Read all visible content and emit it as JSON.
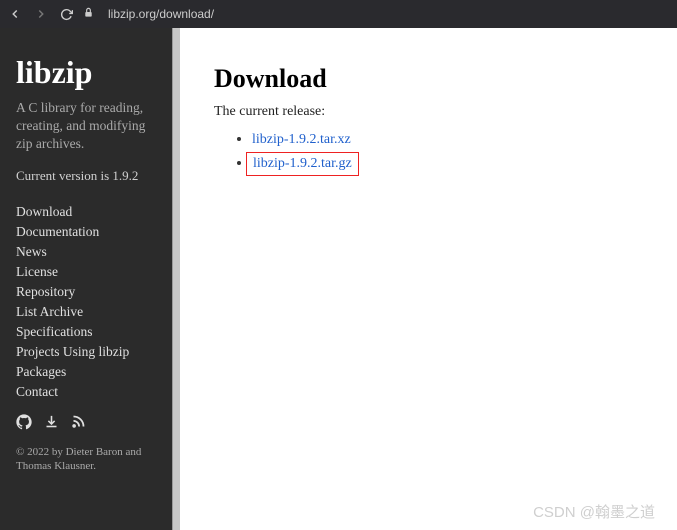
{
  "browser": {
    "url": "libzip.org/download/"
  },
  "sidebar": {
    "title": "libzip",
    "tagline": "A C library for reading, creating, and modifying zip archives.",
    "version_text": "Current version is 1.9.2",
    "nav": [
      "Download",
      "Documentation",
      "News",
      "License",
      "Repository",
      "List Archive",
      "Specifications",
      "Projects Using libzip",
      "Packages",
      "Contact"
    ],
    "copyright": "© 2022 by Dieter Baron and Thomas Klausner."
  },
  "main": {
    "title": "Download",
    "subtitle": "The current release:",
    "releases": [
      {
        "label": "libzip-1.9.2.tar.xz",
        "highlighted": false
      },
      {
        "label": "libzip-1.9.2.tar.gz",
        "highlighted": true
      }
    ]
  },
  "watermark": "CSDN @翰墨之道"
}
